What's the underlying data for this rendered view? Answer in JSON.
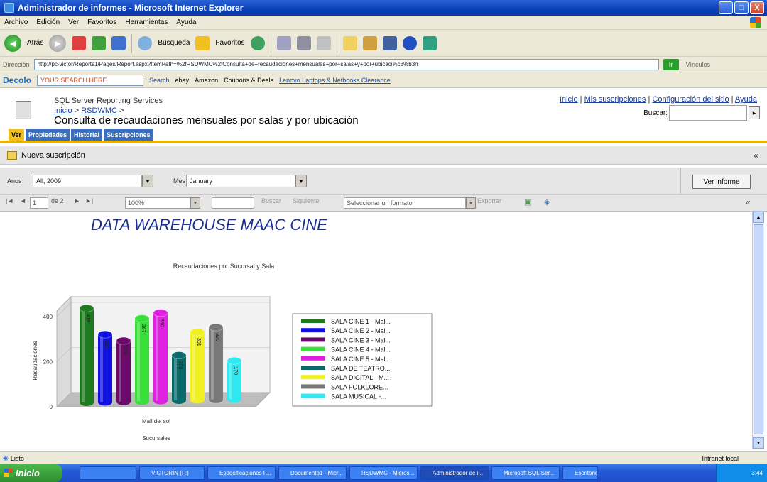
{
  "window": {
    "title": "Administrador de informes - Microsoft Internet Explorer",
    "controls": [
      "_",
      "□",
      "X"
    ]
  },
  "menu": [
    "Archivo",
    "Edición",
    "Ver",
    "Favoritos",
    "Herramientas",
    "Ayuda"
  ],
  "toolbar": {
    "back": "Atrás",
    "search": "Búsqueda",
    "favorites": "Favoritos"
  },
  "address": {
    "label": "Dirección",
    "url": "http://pc-victor/Reports1/Pages/Report.aspx?ItemPath=%2fRSDWMC%2fConsulta+de+recaudaciones+mensuales+por+salas+y+por+ubicaci%c3%b3n",
    "go": "Ir",
    "links": "Vínculos"
  },
  "dealsbar": {
    "brand": "Decolo",
    "search_placeholder": "YOUR SEARCH HERE",
    "search_btn": "Search",
    "ebay": "ebay",
    "amazon": "Amazon",
    "coupons": "Coupons & Deals",
    "link": "Lenovo Laptops & Netbooks Clearance"
  },
  "ssrs": {
    "service": "SQL Server Reporting Services",
    "breadcrumb_home": "Inicio",
    "breadcrumb_folder": "RSDWMC",
    "title": "Consulta de recaudaciones mensuales por salas y por ubicación",
    "links": {
      "home": "Inicio",
      "subs": "Mis suscripciones",
      "config": "Configuración del sitio",
      "help": "Ayuda"
    },
    "search_label": "Buscar:"
  },
  "tabs": [
    "Ver",
    "Propiedades",
    "Historial",
    "Suscripciones"
  ],
  "subscription": {
    "label": "Nueva suscripción",
    "collapse": "«"
  },
  "params": {
    "year_label": "Anos",
    "year_value": "All, 2009",
    "month_label": "Mes",
    "month_value": "January",
    "view_btn": "Ver informe"
  },
  "report_toolbar": {
    "first": "|◄",
    "prev": "◄",
    "page": "1",
    "of": "de 2",
    "next": "►",
    "last": "►|",
    "zoom": "100%",
    "find": "Buscar",
    "next_find": "Siguiente",
    "format": "Seleccionar un formato",
    "export": "Exportar"
  },
  "report": {
    "title": "DATA WAREHOUSE MAAC CINE"
  },
  "chart_data": {
    "type": "bar",
    "title": "Recaudaciones por Sucursal y Sala",
    "xlabel": "Sucursales",
    "ylabel": "Recaudaciones",
    "categories": [
      "Mall del sol"
    ],
    "ylim": [
      0,
      400
    ],
    "yticks": [
      0,
      200,
      400
    ],
    "series": [
      {
        "name": "SALA CINE 1 - Mal...",
        "values": [
          418
        ],
        "color": "#1e7a1e"
      },
      {
        "name": "SALA CINE 2 - Mal...",
        "values": [
          300
        ],
        "color": "#1010e0"
      },
      {
        "name": "SALA CINE 3 - Mal...",
        "values": [
          270
        ],
        "color": "#6a0a6a"
      },
      {
        "name": "SALA CINE 4 - Mal...",
        "values": [
          367
        ],
        "color": "#3ae03a"
      },
      {
        "name": "SALA CINE 5 - Mal...",
        "values": [
          390
        ],
        "color": "#e020e0"
      },
      {
        "name": "SALA DE TEATRO...",
        "values": [
          200
        ],
        "color": "#0a6a6a"
      },
      {
        "name": "SALA DIGITAL - M...",
        "values": [
          301
        ],
        "color": "#f0f020"
      },
      {
        "name": "SALA FOLKLORE...",
        "values": [
          320
        ],
        "color": "#787878"
      },
      {
        "name": "SALA MUSICAL -...",
        "values": [
          170
        ],
        "color": "#30e8f0"
      }
    ]
  },
  "statusbar": {
    "left": "Listo",
    "zone": "Intranet local"
  },
  "taskbar": {
    "start": "Inicio",
    "tasks": [
      "VICTORIN (F:)",
      "Especificaciones F...",
      "Documento1 - Micr...",
      "RSDWMC - Micros...",
      "Administrador de i...",
      "Microsoft SQL Ser...",
      "Escritorio"
    ],
    "clock": "3:44"
  }
}
